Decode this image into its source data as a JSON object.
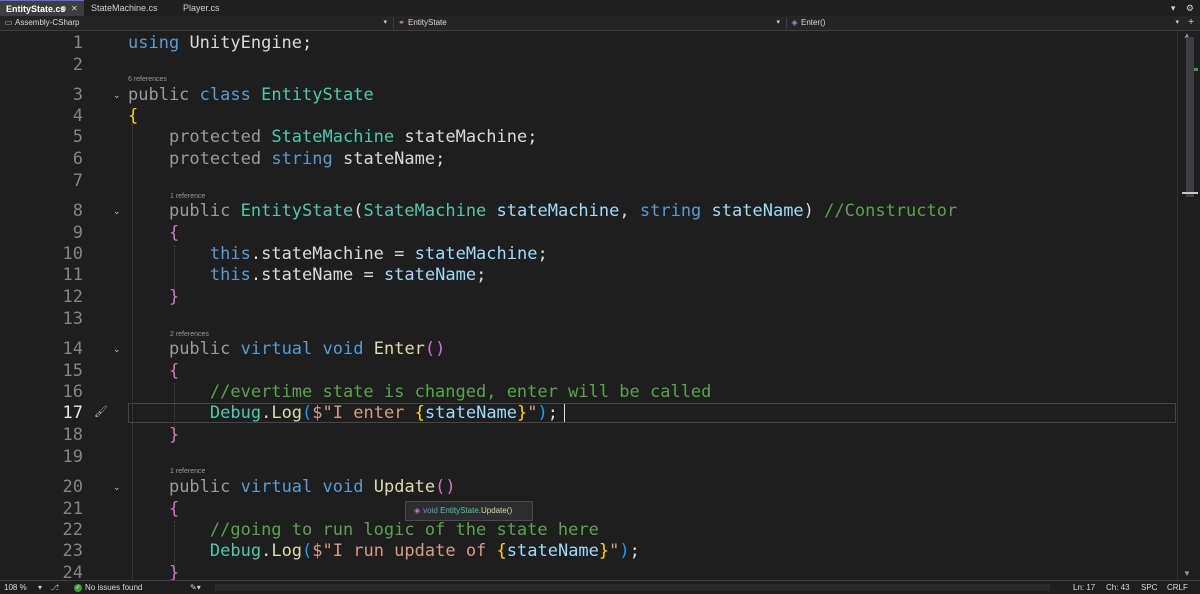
{
  "tabs": [
    {
      "label": "EntityState.cs",
      "active": true
    },
    {
      "label": "StateMachine.cs",
      "active": false
    },
    {
      "label": "Player.cs",
      "active": false
    }
  ],
  "tab_controls": {
    "pin_icon": "pin-icon",
    "close_icon": "close-icon",
    "pin_glyph": "⊕",
    "close_glyph": "✕"
  },
  "strip_right": {
    "dropdown_glyph": "▾",
    "settings_glyph": "⚙"
  },
  "navbar": {
    "project": "Assembly-CSharp",
    "class": "EntityState",
    "member": "Enter()"
  },
  "code_lines": [
    {
      "n": "1"
    },
    {
      "n": "2"
    },
    {
      "n": "3"
    },
    {
      "n": "4"
    },
    {
      "n": "5"
    },
    {
      "n": "6"
    },
    {
      "n": "7"
    },
    {
      "n": "8"
    },
    {
      "n": "9"
    },
    {
      "n": "10"
    },
    {
      "n": "11"
    },
    {
      "n": "12"
    },
    {
      "n": "13"
    },
    {
      "n": "14"
    },
    {
      "n": "15"
    },
    {
      "n": "16"
    },
    {
      "n": "17"
    },
    {
      "n": "18"
    },
    {
      "n": "19"
    },
    {
      "n": "20"
    },
    {
      "n": "21"
    },
    {
      "n": "22"
    },
    {
      "n": "23"
    },
    {
      "n": "24"
    }
  ],
  "code": {
    "l1": {
      "using": "using",
      "ns": "UnityEngine",
      "semi": ";"
    },
    "l3": {
      "public": "public",
      "class": "class",
      "name": "EntityState"
    },
    "l4": {
      "brace": "{"
    },
    "l5": {
      "mod": "protected",
      "type": "StateMachine",
      "name": "stateMachine",
      "semi": ";"
    },
    "l6": {
      "mod": "protected",
      "type": "string",
      "name": "stateName",
      "semi": ";"
    },
    "l8": {
      "mod": "public",
      "name": "EntityState",
      "open": "(",
      "t1": "StateMachine",
      "p1": "stateMachine",
      "comma": ",",
      "t2": "string",
      "p2": "stateName",
      "close": ")",
      "comment": "//Constructor"
    },
    "l9": {
      "brace": "{"
    },
    "l10": {
      "this": "this",
      "dot": ".",
      "field": "stateMachine",
      "eq": " = ",
      "val": "stateMachine",
      "semi": ";"
    },
    "l11": {
      "this": "this",
      "dot": ".",
      "field": "stateName",
      "eq": " = ",
      "val": "stateName",
      "semi": ";"
    },
    "l12": {
      "brace": "}"
    },
    "l14": {
      "mod": "public",
      "virt": "virtual",
      "void": "void",
      "name": "Enter",
      "parens": "()"
    },
    "l15": {
      "brace": "{"
    },
    "l16": {
      "comment": "//evertime state is changed, enter will be called"
    },
    "l17": {
      "cls": "Debug",
      "dot": ".",
      "fn": "Log",
      "open": "(",
      "s1": "$\"I enter ",
      "bo": "{",
      "var": "stateName",
      "bc": "}",
      "s2": "\"",
      "close": ")",
      "semi": ";"
    },
    "l18": {
      "brace": "}"
    },
    "l20": {
      "mod": "public",
      "virt": "virtual",
      "void": "void",
      "name": "Update",
      "parens": "()"
    },
    "l21": {
      "brace": "{"
    },
    "l22": {
      "comment": "//going to run logic of the state here"
    },
    "l23": {
      "cls": "Debug",
      "dot": ".",
      "fn": "Log",
      "open": "(",
      "s1": "$\"I run update of ",
      "bo": "{",
      "var": "stateName",
      "bc": "}",
      "s2": "\"",
      "close": ")",
      "semi": ";"
    },
    "l24": {
      "brace": "}"
    }
  },
  "references": {
    "class": "6 references",
    "ctor": "1 reference",
    "enter": "2 references",
    "update": "1 reference"
  },
  "tooltip": {
    "void": "void",
    "cls": "EntityState",
    "member": ".Update()"
  },
  "status": {
    "zoom": "108 %",
    "issues": "No issues found",
    "ln": "Ln: 17",
    "ch": "Ch: 43",
    "spc": "SPC",
    "eol": "CRLF"
  },
  "colors": {
    "keyword": "#569cd6",
    "type": "#4ec9b0",
    "method": "#dcdcaa",
    "parameter": "#9cdcfe",
    "comment": "#57a64a",
    "string": "#d69d85",
    "brace_level1": "#ffd700",
    "brace_level2": "#da70d6",
    "brace_level3": "#179fff"
  }
}
